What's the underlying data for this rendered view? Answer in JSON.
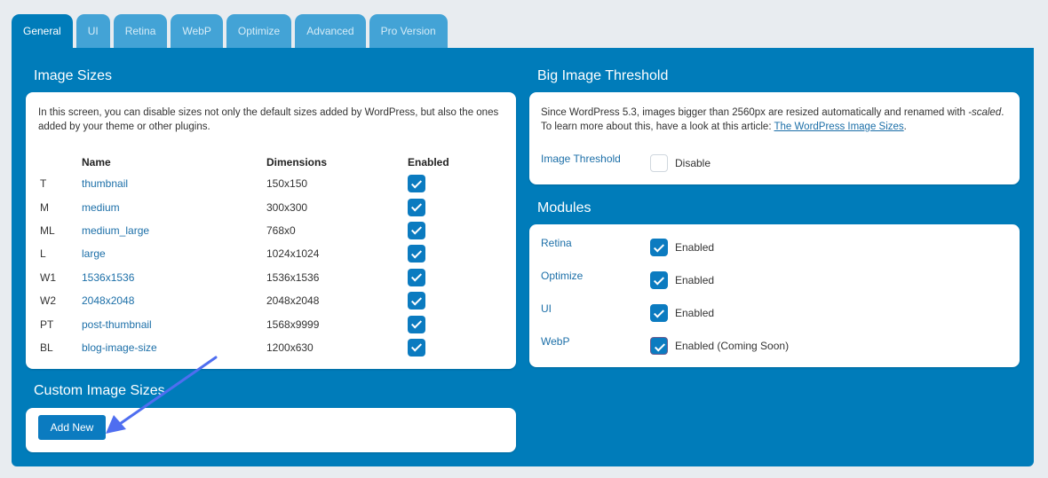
{
  "tabs": [
    {
      "label": "General",
      "active": true
    },
    {
      "label": "UI",
      "active": false
    },
    {
      "label": "Retina",
      "active": false
    },
    {
      "label": "WebP",
      "active": false
    },
    {
      "label": "Optimize",
      "active": false
    },
    {
      "label": "Advanced",
      "active": false
    },
    {
      "label": "Pro Version",
      "active": false
    }
  ],
  "image_sizes": {
    "title": "Image Sizes",
    "description": "In this screen, you can disable sizes not only the default sizes added by WordPress, but also the ones added by your theme or other plugins.",
    "columns": [
      "",
      "Name",
      "Dimensions",
      "Enabled"
    ],
    "rows": [
      {
        "code": "T",
        "name": "thumbnail",
        "dimensions": "150x150",
        "enabled": true
      },
      {
        "code": "M",
        "name": "medium",
        "dimensions": "300x300",
        "enabled": true
      },
      {
        "code": "ML",
        "name": "medium_large",
        "dimensions": "768x0",
        "enabled": true
      },
      {
        "code": "L",
        "name": "large",
        "dimensions": "1024x1024",
        "enabled": true
      },
      {
        "code": "W1",
        "name": "1536x1536",
        "dimensions": "1536x1536",
        "enabled": true
      },
      {
        "code": "W2",
        "name": "2048x2048",
        "dimensions": "2048x2048",
        "enabled": true
      },
      {
        "code": "PT",
        "name": "post-thumbnail",
        "dimensions": "1568x9999",
        "enabled": true
      },
      {
        "code": "BL",
        "name": "blog-image-size",
        "dimensions": "1200x630",
        "enabled": true
      }
    ]
  },
  "custom_image_sizes": {
    "title": "Custom Image Sizes",
    "add_new_label": "Add New"
  },
  "big_image_threshold": {
    "title": "Big Image Threshold",
    "desc_part1": "Since WordPress 5.3, images bigger than 2560px are resized automatically and renamed with ",
    "desc_em": "-scaled",
    "desc_part2": ".",
    "desc_part3": "To learn more about this, have a look at this article: ",
    "link_text": "The WordPress Image Sizes",
    "desc_part4": ".",
    "field_label": "Image Threshold",
    "checkbox_label": "Disable",
    "checked": false
  },
  "modules": {
    "title": "Modules",
    "items": [
      {
        "label": "Retina",
        "value": "Enabled",
        "checked": true
      },
      {
        "label": "Optimize",
        "value": "Enabled",
        "checked": true
      },
      {
        "label": "UI",
        "value": "Enabled",
        "checked": true
      },
      {
        "label": "WebP",
        "value": "Enabled (Coming Soon)",
        "checked": true
      }
    ]
  },
  "colors": {
    "panel": "#007cba",
    "tab_inactive": "#43a3d6",
    "checkbox": "#0b7bc0",
    "link": "#1c6fa8",
    "annotation_arrow": "#4f6ef0"
  }
}
